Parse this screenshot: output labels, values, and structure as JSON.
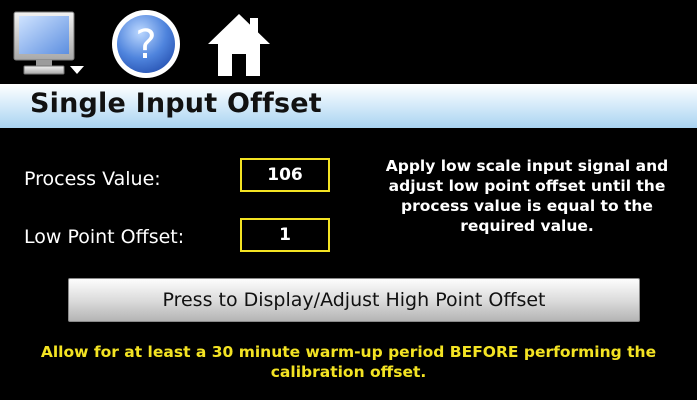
{
  "toolbar": {
    "icons": [
      "monitor-icon",
      "help-icon",
      "home-icon"
    ]
  },
  "header": {
    "title": "Single Input Offset"
  },
  "fields": {
    "process_value_label": "Process Value:",
    "process_value": "106",
    "low_point_offset_label": "Low Point Offset:",
    "low_point_offset": "1"
  },
  "instructions": "Apply low scale input signal and adjust low point offset until the process value is equal to the required value.",
  "high_offset_button_label": "Press to Display/Adjust High Point Offset",
  "warning": "Allow for at least a 30 minute warm-up period BEFORE performing the calibration offset.",
  "colors": {
    "background": "#000000",
    "accent_yellow": "#f3e323",
    "title_bar": "#a9d3f1"
  }
}
